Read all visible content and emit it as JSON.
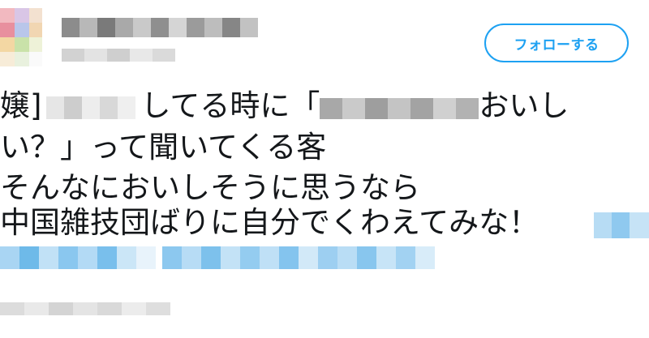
{
  "header": {
    "follow_button_label": "フォローする"
  },
  "tweet": {
    "line1": {
      "seg1": "嬢]",
      "seg2": "してる時に「",
      "seg3": "おいし"
    },
    "line2": "い？」って聞いてくる客",
    "line3": "そんなにおいしそうに思うなら",
    "line4": "中国雑技団ばりに自分でくわえてみな！"
  },
  "colors": {
    "accent": "#1da1f2",
    "text": "#14171a"
  },
  "icons": {
    "avatar": "avatar-image"
  }
}
